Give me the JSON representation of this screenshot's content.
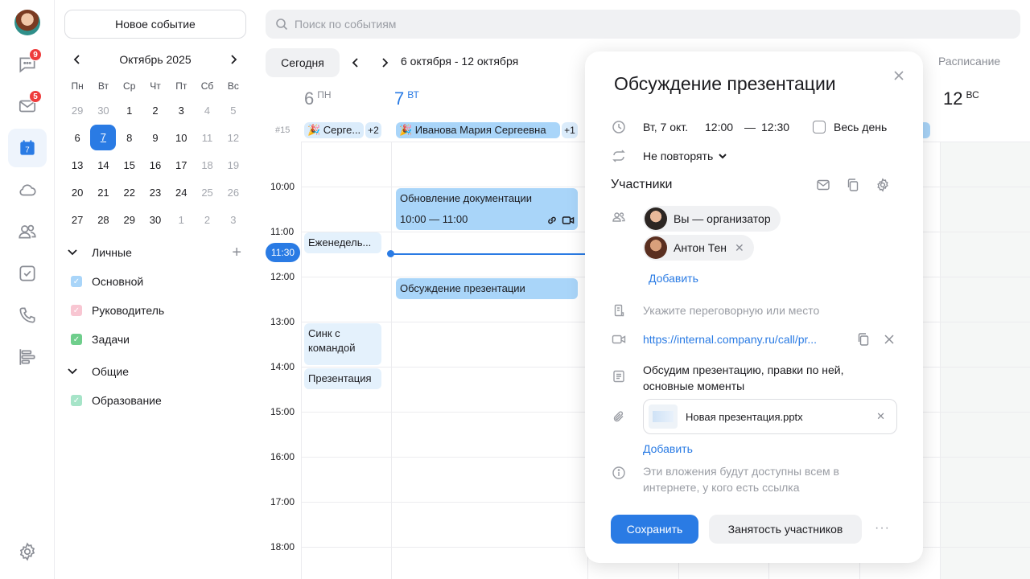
{
  "rail": {
    "chat_badge": "9",
    "mail_badge": "5",
    "calendar_day": "7"
  },
  "sidebar": {
    "new_event": "Новое событие",
    "month": "Октябрь 2025",
    "dows": [
      "Пн",
      "Вт",
      "Ср",
      "Чт",
      "Пт",
      "Сб",
      "Вс"
    ],
    "weeks": [
      [
        "29",
        "30",
        "1",
        "2",
        "3",
        "4",
        "5"
      ],
      [
        "6",
        "7",
        "8",
        "9",
        "10",
        "11",
        "12"
      ],
      [
        "13",
        "14",
        "15",
        "16",
        "17",
        "18",
        "19"
      ],
      [
        "20",
        "21",
        "22",
        "23",
        "24",
        "25",
        "26"
      ],
      [
        "27",
        "28",
        "29",
        "30",
        "1",
        "2",
        "3"
      ]
    ],
    "personal_group": "Личные",
    "personal_calendars": [
      {
        "label": "Основной",
        "color": "#a9d5f9"
      },
      {
        "label": "Руководитель",
        "color": "#f8c6d2"
      },
      {
        "label": "Задачи",
        "color": "#6fce8c"
      }
    ],
    "shared_group": "Общие",
    "shared_calendars": [
      {
        "label": "Образование",
        "color": "#a6e4c8"
      }
    ]
  },
  "toolbar": {
    "search_placeholder": "Поиск по событиям",
    "today": "Сегодня",
    "range": "6 октября - 12 октября",
    "view": "Расписание"
  },
  "grid": {
    "week_number": "#15",
    "days": [
      {
        "num": "6",
        "dow": "ПН"
      },
      {
        "num": "7",
        "dow": "ВТ"
      },
      {
        "num": "12",
        "dow": "ВС"
      }
    ],
    "times": [
      "10:00",
      "11:00",
      "12:00",
      "13:00",
      "14:00",
      "15:00",
      "16:00",
      "17:00",
      "18:00"
    ],
    "now": "11:30",
    "allday_mon": "🎉 Серге...",
    "allday_mon_more": "+2",
    "allday_tue": "🎉 Иванова Мария Сергеевна",
    "allday_tue_more": "+1",
    "events": {
      "docs_title": "Обновление документации",
      "docs_time": "10:00 — 11:00",
      "weekly": "Еженедель...",
      "discussion": "Обсуждение презентации",
      "sync": "Синк с командой",
      "presentation": "Презентация"
    }
  },
  "modal": {
    "title": "Обсуждение презентации",
    "date": "Вт, 7 окт.",
    "start": "12:00",
    "dash": "—",
    "end": "12:30",
    "all_day": "Весь день",
    "repeat": "Не повторять",
    "participants_label": "Участники",
    "participants": [
      {
        "name": "Вы — организатор",
        "removable": false
      },
      {
        "name": "Антон Тен",
        "removable": true
      }
    ],
    "add_participant": "Добавить",
    "location_placeholder": "Укажите переговорную или место",
    "call_link": "https://internal.company.ru/call/pr...",
    "description": "Обсудим презентацию, правки по ней, основные моменты",
    "attachment": "Новая презентация.pptx",
    "add_attachment": "Добавить",
    "notice": "Эти вложения будут доступны всем в интернете, у кого есть ссылка",
    "save": "Сохранить",
    "busy": "Занятость участников",
    "more": "···"
  }
}
